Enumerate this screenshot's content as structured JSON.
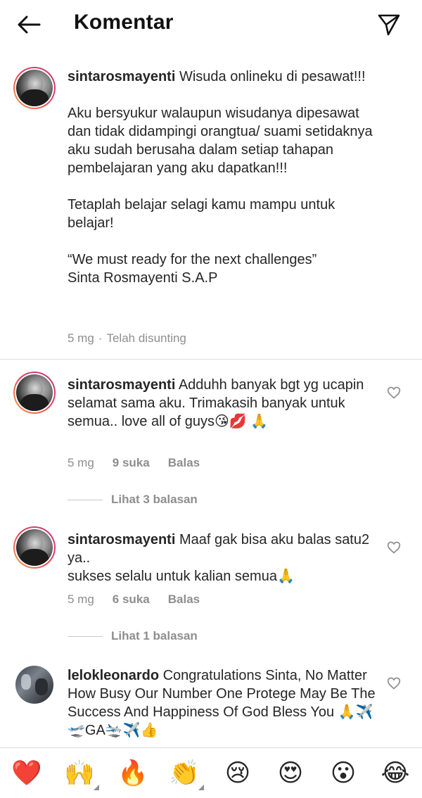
{
  "header": {
    "title": "Komentar",
    "back_icon": "arrow-left-icon",
    "send_icon": "paper-plane-icon"
  },
  "caption": {
    "username": "sintarosmayenti",
    "first_line": " Wisuda onlineku di pesawat!!!",
    "para2": "Aku bersyukur walaupun wisudanya dipesawat dan tidak didampingi orangtua/ suami setidaknya aku sudah berusaha dalam setiap tahapan pembelajaran yang aku dapatkan!!!",
    "para3": "Tetaplah belajar selagi kamu mampu untuk belajar!",
    "para4_line1": "“We must ready for the next challenges”",
    "para4_line2": "Sinta Rosmayenti S.A.P",
    "time": "5 mg",
    "separator": "·",
    "edited": "Telah disunting"
  },
  "comments": [
    {
      "username": "sintarosmayenti",
      "text": " Adduhh banyak bgt yg ucapin selamat sama aku. Trimakasih banyak untuk semua.. love all of guys😘💋 🙏",
      "time": "5 mg",
      "likes": "9 suka",
      "reply": "Balas",
      "view_replies": "Lihat 3 balasan"
    },
    {
      "username": "sintarosmayenti",
      "text_line1": " Maaf gak bisa aku balas satu2 ya..",
      "text_line2": "sukses selalu untuk kalian semua🙏",
      "time": "5 mg",
      "likes": "6 suka",
      "reply": "Balas",
      "view_replies": "Lihat 1 balasan"
    },
    {
      "username": "lelokleonardo",
      "text": " Congratulations Sinta, No Matter How Busy Our Number One Protege May Be The Success And Happiness Of God Bless You 🙏✈️🛫GA🛬✈️👍"
    }
  ],
  "emoji_bar": [
    "❤️",
    "🙌",
    "🔥",
    "👏",
    "😢",
    "😍",
    "😮",
    "😂"
  ],
  "colors": {
    "text": "#262626",
    "muted": "#8e8e8e",
    "divider": "#dbdbdb",
    "story_ring_start": "#f9a03f",
    "story_ring_end": "#c13584"
  }
}
